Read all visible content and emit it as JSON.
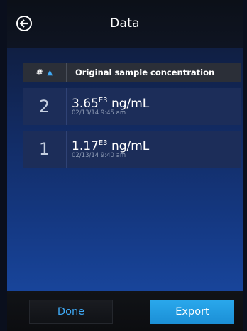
{
  "header": {
    "title": "Data",
    "back_icon": "arrow-left-circle-icon"
  },
  "table": {
    "columns": {
      "number_label": "#",
      "sort_icon": "chevron-up-icon",
      "concentration_label": "Original sample concentration"
    },
    "rows": [
      {
        "number": "2",
        "value": "3.65",
        "exponent": "E3",
        "unit": "ng/mL",
        "timestamp": "02/13/14 9:45 am"
      },
      {
        "number": "1",
        "value": "1.17",
        "exponent": "E3",
        "unit": "ng/mL",
        "timestamp": "02/13/14 9:40 am"
      }
    ]
  },
  "footer": {
    "done_label": "Done",
    "export_label": "Export"
  },
  "colors": {
    "accent": "#3fa9f5",
    "export_button": "#1b8fd6",
    "row_background": "#1c2d59"
  }
}
